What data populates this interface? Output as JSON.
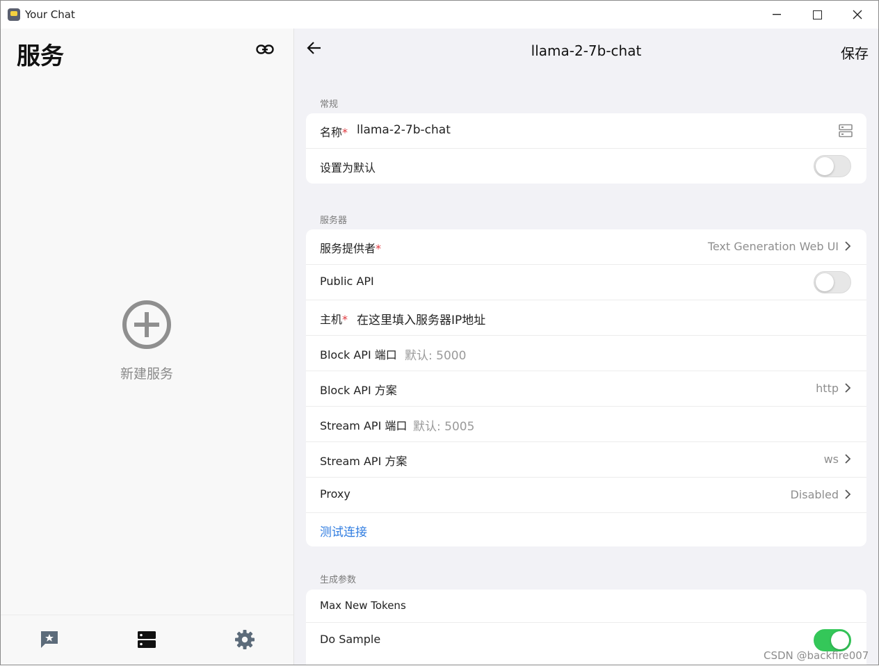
{
  "window": {
    "title": "Your Chat"
  },
  "left": {
    "title": "服务",
    "new_service_label": "新建服务"
  },
  "right": {
    "title": "llama-2-7b-chat",
    "save_label": "保存",
    "sections": {
      "general": {
        "label": "常规",
        "name_label": "名称",
        "name_value": "llama-2-7b-chat",
        "default_label": "设置为默认",
        "default_on": false
      },
      "server": {
        "label": "服务器",
        "provider_label": "服务提供者",
        "provider_value": "Text Generation Web UI",
        "public_api_label": "Public API",
        "public_api_on": false,
        "host_label": "主机",
        "host_placeholder": "在这里填入服务器IP地址",
        "block_port_label": "Block API 端口",
        "block_port_placeholder": "默认: 5000",
        "block_scheme_label": "Block API 方案",
        "block_scheme_value": "http",
        "stream_port_label": "Stream API 端口",
        "stream_port_placeholder": "默认: 5005",
        "stream_scheme_label": "Stream API 方案",
        "stream_scheme_value": "ws",
        "proxy_label": "Proxy",
        "proxy_value": "Disabled",
        "test_label": "测试连接"
      },
      "generation": {
        "label": "生成参数",
        "max_tokens_label": "Max New Tokens",
        "do_sample_label": "Do Sample",
        "do_sample_on": true
      }
    }
  },
  "required_mark": "*",
  "watermark": "CSDN @backfire007",
  "colors": {
    "accent_link": "#2f7ce0",
    "toggle_on": "#34c759",
    "required": "#e0383e"
  }
}
